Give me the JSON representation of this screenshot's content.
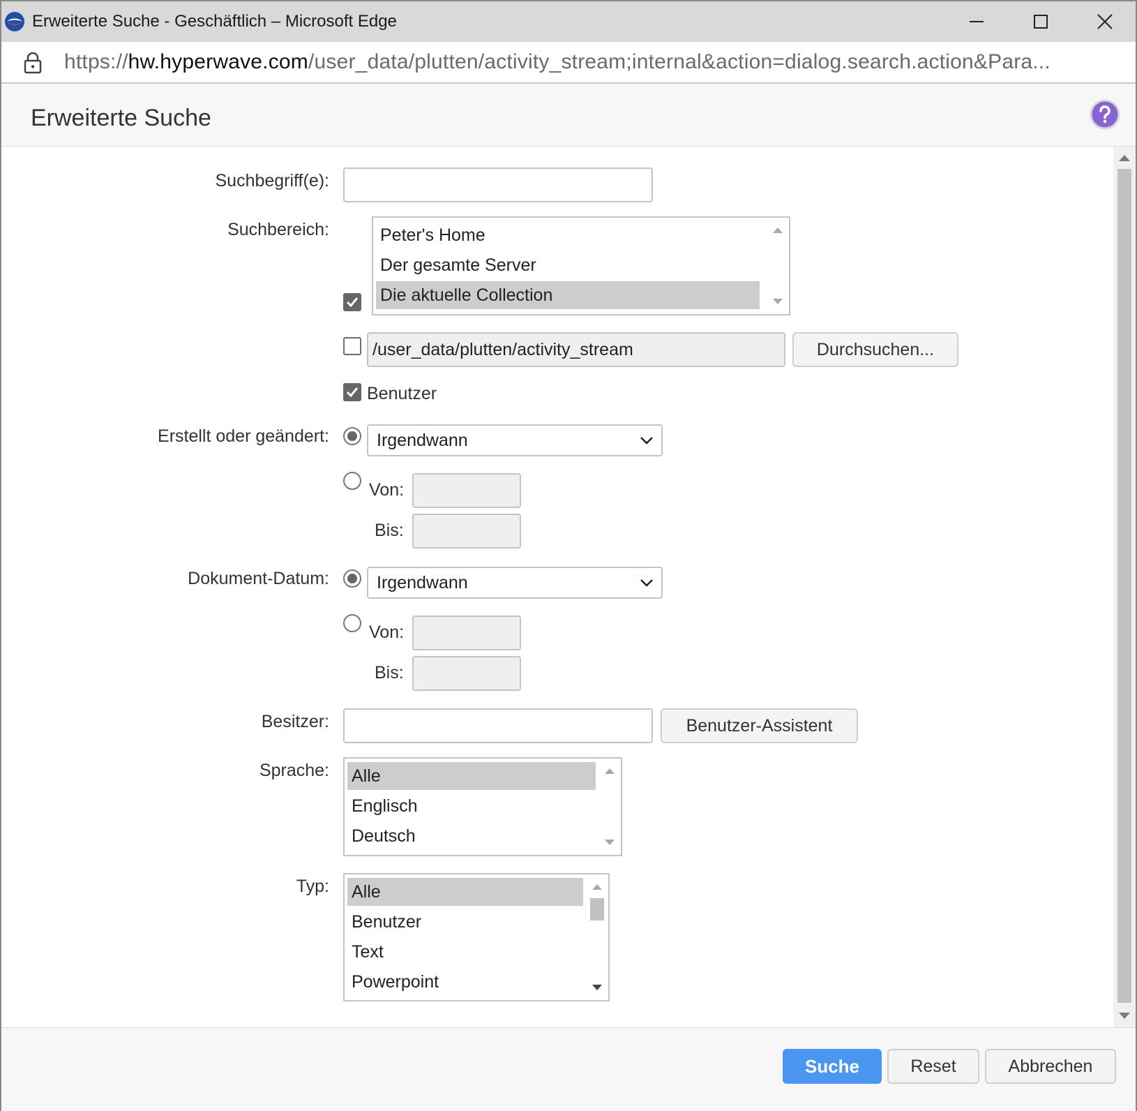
{
  "window": {
    "title": "Erweiterte Suche - Geschäftlich – Microsoft Edge",
    "url_scheme": "https://",
    "url_host": "hw.hyperwave.com",
    "url_path": "/user_data/plutten/activity_stream;internal&action=dialog.search.action&Para..."
  },
  "dialog": {
    "title": "Erweiterte Suche",
    "help_icon": "question-mark-icon"
  },
  "form": {
    "search_terms_label": "Suchbegriff(e):",
    "search_terms_value": "",
    "scope_label": "Suchbereich:",
    "scope_options": [
      {
        "label": "Peter's Home",
        "selected": false
      },
      {
        "label": "Der gesamte Server",
        "selected": false
      },
      {
        "label": "Die aktuelle Collection",
        "selected": true
      }
    ],
    "scope_checkbox_checked": true,
    "path_checkbox_checked": false,
    "path_value": "/user_data/plutten/activity_stream",
    "browse_button": "Durchsuchen...",
    "users_checkbox_checked": true,
    "users_label": "Benutzer",
    "modified_label": "Erstellt oder geändert:",
    "modified_select": "Irgendwann",
    "from_label": "Von:",
    "to_label": "Bis:",
    "doc_date_label": "Dokument-Datum:",
    "doc_date_select": "Irgendwann",
    "owner_label": "Besitzer:",
    "owner_value": "",
    "user_assistant_button": "Benutzer-Assistent",
    "language_label": "Sprache:",
    "language_options": [
      {
        "label": "Alle",
        "selected": true
      },
      {
        "label": "Englisch",
        "selected": false
      },
      {
        "label": "Deutsch",
        "selected": false
      }
    ],
    "type_label": "Typ:",
    "type_options": [
      {
        "label": "Alle",
        "selected": true
      },
      {
        "label": "Benutzer",
        "selected": false
      },
      {
        "label": "Text",
        "selected": false
      },
      {
        "label": "Powerpoint",
        "selected": false
      }
    ]
  },
  "footer": {
    "search_button": "Suche",
    "reset_button": "Reset",
    "cancel_button": "Abbrechen"
  },
  "colors": {
    "primary": "#4a96f0",
    "help": "#8a63d2",
    "titlebar": "#d9d9d9"
  }
}
